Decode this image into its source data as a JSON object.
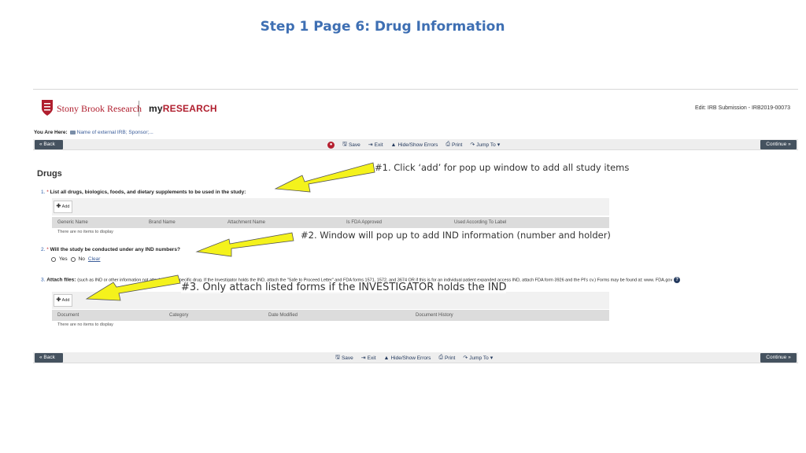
{
  "slide": {
    "title": "Step 1 Page 6: Drug Information"
  },
  "header": {
    "org": "Stony Brook Research",
    "app_prefix": "my",
    "app_suffix": "RESEARCH",
    "edit_label": "Edit: IRB Submission - IRB2019-00073"
  },
  "breadcrumb": {
    "label": "You Are Here:",
    "path": "Name of external IRB; Sponsor;..."
  },
  "toolbar": {
    "back": "« Back",
    "save": "Save",
    "exit": "Exit",
    "hide_show": "Hide/Show Errors",
    "print": "Print",
    "jump": "Jump To",
    "continue": "Continue »"
  },
  "page": {
    "heading": "Drugs"
  },
  "q1": {
    "num": "1.",
    "label": "List all drugs, biologics, foods, and dietary supplements to be used in the study:",
    "add": "Add",
    "columns": [
      "Generic Name",
      "Brand Name",
      "Attachment Name",
      "Is FDA Approved",
      "Used According To Label"
    ],
    "empty": "There are no items to display"
  },
  "q2": {
    "num": "2.",
    "label": "Will the study be conducted under any IND numbers?",
    "yes": "Yes",
    "no": "No",
    "clear": "Clear"
  },
  "q3": {
    "num": "3.",
    "label": "Attach files:",
    "desc": "(such as IND or other information not attached for a specific drug. If the Investigator holds the IND, attach the \"Safe to Proceed Letter\" and FDA forms 1571, 1572, and 3674 OR if this is for an individual patient expanded access IND, attach FDA form 3926 and the PI's cv.) Forms may be found at: www. FDA.gov",
    "add": "Add",
    "columns": [
      "Document",
      "Category",
      "Date Modified",
      "Document History"
    ],
    "empty": "There are no items to display"
  },
  "callouts": {
    "c1": "#1. Click ‘add’ for pop up window to add all study items",
    "c2": "#2. Window will pop up to add IND information (number and holder)",
    "c3": "#3. Only attach listed forms if the INVESTIGATOR holds the IND"
  },
  "colors": {
    "title": "#3e6fb3",
    "brand_red": "#b01e2e",
    "toolbar_dark": "#45525f",
    "arrow_fill": "#f4f21c"
  },
  "icons": [
    "shield-logo-icon",
    "folder-icon",
    "save-icon",
    "exit-icon",
    "warning-icon",
    "print-icon",
    "jump-icon",
    "plus-icon",
    "help-icon"
  ]
}
